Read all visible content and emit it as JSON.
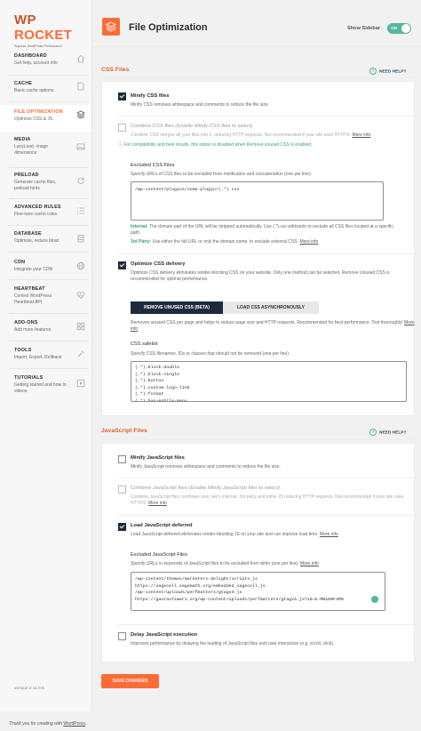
{
  "brand": {
    "logo": "WP ROCKET",
    "logo_wp": "WP",
    "logo_rocket": "ROCKET",
    "tagline": "Superior WordPress Performance"
  },
  "sidebar": {
    "items": [
      {
        "title": "DASHBOARD",
        "desc": "Get help, account info",
        "icon": "home-icon"
      },
      {
        "title": "CACHE",
        "desc": "Basic cache options",
        "icon": "file-icon"
      },
      {
        "title": "FILE OPTIMIZATION",
        "desc": "Optimize CSS & JS",
        "icon": "layers-icon"
      },
      {
        "title": "MEDIA",
        "desc": "LazyLoad, image dimensions",
        "icon": "image-icon"
      },
      {
        "title": "PRELOAD",
        "desc": "Generate cache files, preload fonts",
        "icon": "refresh-icon"
      },
      {
        "title": "ADVANCED RULES",
        "desc": "Fine-tune cache rules",
        "icon": "list-icon"
      },
      {
        "title": "DATABASE",
        "desc": "Optimize, reduce bloat",
        "icon": "database-icon"
      },
      {
        "title": "CDN",
        "desc": "Integrate your CDN",
        "icon": "globe-icon"
      },
      {
        "title": "HEARTBEAT",
        "desc": "Control WordPress Heartbeat API",
        "icon": "heart-icon"
      },
      {
        "title": "ADD-ONS",
        "desc": "Add more features",
        "icon": "puzzle-icon"
      },
      {
        "title": "TOOLS",
        "desc": "Import, Export, Rollback",
        "icon": "tools-icon"
      },
      {
        "title": "TUTORIALS",
        "desc": "Getting started and how to videos",
        "icon": "video-icon"
      }
    ],
    "version": "version 3.11.0.5"
  },
  "header": {
    "title": "File Optimization",
    "show_sidebar": "Show Sidebar",
    "toggle": "ON"
  },
  "css": {
    "section_title": "CSS Files",
    "help": "NEED HELP?",
    "minify_title": "Minify CSS files",
    "minify_desc": "Minify CSS removes whitespace and comments to reduce the file size.",
    "combine_title": "Combine CSS files",
    "combine_hint": "(Enable Minify CSS files to select)",
    "combine_desc": "Combine CSS merges all your files into 1, reducing HTTP requests. Not recommended if your site uses HTTP/2.",
    "more_info": "More info",
    "compat_note": "For compatibility and best results, this option is disabled when Remove unused CSS is enabled.",
    "excluded_title": "Excluded CSS Files",
    "excluded_desc": "Specify URLs of CSS files to be excluded from minification and concatenation (one per line).",
    "excluded_value": "/wp-content/plugins/some-plugin/(.*).css",
    "internal_label": "Internal:",
    "internal_text": " The domain part of the URL will be stripped automatically. Use (.*).css wildcards to exclude all CSS files located at a specific path.",
    "third_label": "3rd Party:",
    "third_text": " Use either the full URL or only the domain name, to exclude external CSS.",
    "delivery_title": "Optimize CSS delivery",
    "delivery_desc": "Optimize CSS delivery eliminates render-blocking CSS on your website. Only one method can be selected. Remove Unused CSS is recommended for optimal performance.",
    "tab_remove": "REMOVE UNUSED CSS (BETA)",
    "tab_async": "LOAD CSS ASYNCHRONOUSLY",
    "remove_desc": "Removes unused CSS per page and helps to reduce page size and HTTP requests. Recommended for best performance. Test thoroughly!",
    "safelist_title": "CSS safelist",
    "safelist_desc": "Specify CSS filenames, IDs or classes that should not be removed (one per line).",
    "safelist_value": "(.*).block-double\n(.*).block-single\n(.*).button\n(.*).custom-logo-link\n(.*).format\n(.*).has-mobile-menu"
  },
  "js": {
    "section_title": "JavaScript Files",
    "help": "NEED HELP?",
    "minify_title": "Minify JavaScript files",
    "minify_desc": "Minify JavaScript removes whitespace and comments to reduce the file size.",
    "combine_title": "Combine JavaScript files",
    "combine_hint": "(Enable Minify JavaScript files to select)",
    "combine_desc": "Combine JavaScript files combines your site's internal, 3rd party and inline JS reducing HTTP requests. Not recommended if your site uses HTTP/2.",
    "defer_title": "Load JavaScript deferred",
    "defer_desc": "Load JavaScript deferred eliminates render-blocking JS on your site and can improve load time.",
    "excl_title": "Excluded JavaScript Files",
    "excl_desc": "Specify URLs or keywords of JavaScript files to be excluded from defer (one per line).",
    "excl_value": "/wp-content/themes/marketers-delight/scripts.js\nhttps://sagecell.sagemath.org/embedded_sagecell.js\n/wp-content/uploads/perfmatters/gtagv4.js\nhttps://gauravtiwari.org/wp-content/uploads/perfmatters/gtagv4.js?id=G-MW160F4M0",
    "delay_title": "Delay JavaScript execution",
    "delay_desc": "Improves performance by delaying the loading of JavaScript files until user interaction (e.g. scroll, click).",
    "more_info": "More info"
  },
  "save_label": "SAVE CHANGES",
  "footer": {
    "text": "Thank you for creating with ",
    "link": "WordPress",
    "end": "."
  }
}
